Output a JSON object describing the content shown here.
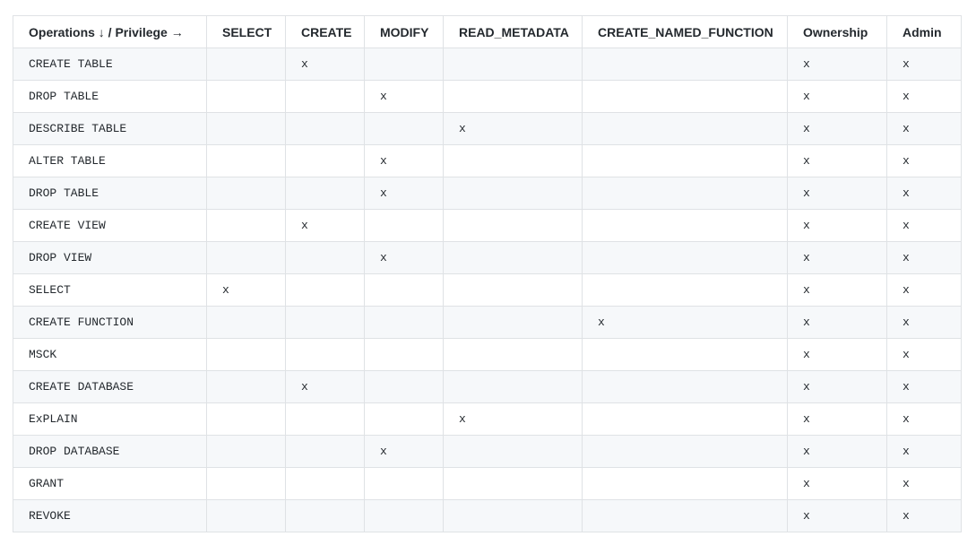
{
  "table": {
    "headers": [
      "Operations ↓ / Privilege →",
      "SELECT",
      "CREATE",
      "MODIFY",
      "READ_METADATA",
      "CREATE_NAMED_FUNCTION",
      "Ownership",
      "Admin"
    ],
    "rows": [
      [
        "CREATE TABLE",
        "",
        "x",
        "",
        "",
        "",
        "x",
        "x"
      ],
      [
        "DROP TABLE",
        "",
        "",
        "x",
        "",
        "",
        "x",
        "x"
      ],
      [
        "DESCRIBE TABLE",
        "",
        "",
        "",
        "x",
        "",
        "x",
        "x"
      ],
      [
        "ALTER TABLE",
        "",
        "",
        "x",
        "",
        "",
        "x",
        "x"
      ],
      [
        "DROP TABLE",
        "",
        "",
        "x",
        "",
        "",
        "x",
        "x"
      ],
      [
        "CREATE VIEW",
        "",
        "x",
        "",
        "",
        "",
        "x",
        "x"
      ],
      [
        "DROP VIEW",
        "",
        "",
        "x",
        "",
        "",
        "x",
        "x"
      ],
      [
        "SELECT",
        "x",
        "",
        "",
        "",
        "",
        "x",
        "x"
      ],
      [
        "CREATE FUNCTION",
        "",
        "",
        "",
        "",
        "x",
        "x",
        "x"
      ],
      [
        "MSCK",
        "",
        "",
        "",
        "",
        "",
        "x",
        "x"
      ],
      [
        "CREATE DATABASE",
        "",
        "x",
        "",
        "",
        "",
        "x",
        "x"
      ],
      [
        "ExPLAIN",
        "",
        "",
        "",
        "x",
        "",
        "x",
        "x"
      ],
      [
        "DROP DATABASE",
        "",
        "",
        "x",
        "",
        "",
        "x",
        "x"
      ],
      [
        "GRANT",
        "",
        "",
        "",
        "",
        "",
        "x",
        "x"
      ],
      [
        "REVOKE",
        "",
        "",
        "",
        "",
        "",
        "x",
        "x"
      ]
    ]
  }
}
